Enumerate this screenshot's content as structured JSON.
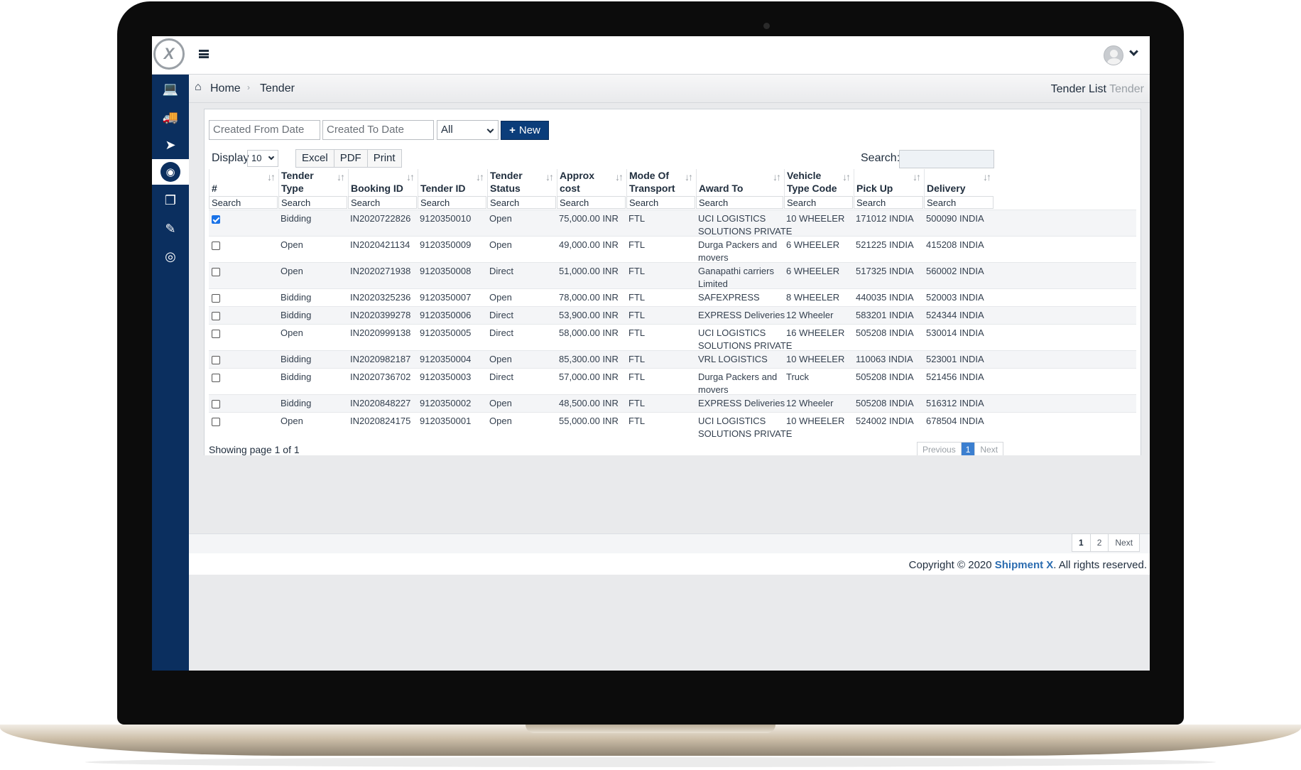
{
  "app": {
    "logo_letter": "X",
    "breadcrumb": {
      "home": "Home",
      "separator": "›",
      "current": "Tender"
    },
    "page_title": {
      "main": "Tender List",
      "sub": "Tender"
    }
  },
  "sidebar": {
    "items": [
      {
        "icon": "laptop-icon",
        "glyph": "💻"
      },
      {
        "icon": "truck-icon",
        "glyph": "🚚"
      },
      {
        "icon": "paper-plane-icon",
        "glyph": "➤"
      },
      {
        "icon": "eye-icon",
        "glyph": "◉",
        "active": true
      },
      {
        "icon": "copy-icon",
        "glyph": "❐"
      },
      {
        "icon": "pill-icon",
        "glyph": "✎"
      },
      {
        "icon": "target-icon",
        "glyph": "◎"
      }
    ]
  },
  "filters": {
    "from_placeholder": "Created From Date",
    "to_placeholder": "Created To Date",
    "status_value": "All",
    "new_button": "New",
    "new_icon": "+"
  },
  "toolbar": {
    "display_label": "Display",
    "display_value": "10",
    "excel": "Excel",
    "pdf": "PDF",
    "print": "Print",
    "search_label": "Search:"
  },
  "table": {
    "columns": [
      {
        "line1": "",
        "line2": "#"
      },
      {
        "line1": "Tender",
        "line2": "Type"
      },
      {
        "line1": "",
        "line2": "Booking ID"
      },
      {
        "line1": "",
        "line2": "Tender ID"
      },
      {
        "line1": "Tender",
        "line2": "Status"
      },
      {
        "line1": "Approx",
        "line2": "cost"
      },
      {
        "line1": "Mode Of",
        "line2": "Transport"
      },
      {
        "line1": "",
        "line2": "Award To"
      },
      {
        "line1": "Vehicle",
        "line2": "Type Code"
      },
      {
        "line1": "",
        "line2": "Pick Up"
      },
      {
        "line1": "",
        "line2": "Delivery"
      }
    ],
    "search_placeholder": "Search",
    "rows": [
      {
        "checked": true,
        "type": "Bidding",
        "booking": "IN2020722826",
        "tender_id": "9120350010",
        "status": "Open",
        "cost": "75,000.00 INR",
        "mode": "FTL",
        "award": [
          "UCI LOGISTICS",
          "SOLUTIONS PRIVATE"
        ],
        "vehicle": "10 WHEELER",
        "pickup": "171012 INDIA",
        "delivery": "500090 INDIA"
      },
      {
        "checked": false,
        "type": "Open",
        "booking": "IN2020421134",
        "tender_id": "9120350009",
        "status": "Open",
        "cost": "49,000.00 INR",
        "mode": "FTL",
        "award": [
          "Durga Packers and",
          "movers"
        ],
        "vehicle": "6 WHEELER",
        "pickup": "521225 INDIA",
        "delivery": "415208 INDIA"
      },
      {
        "checked": false,
        "type": "Open",
        "booking": "IN2020271938",
        "tender_id": "9120350008",
        "status": "Direct",
        "cost": "51,000.00 INR",
        "mode": "FTL",
        "award": [
          "Ganapathi carriers",
          "Limited"
        ],
        "vehicle": "6 WHEELER",
        "pickup": "517325 INDIA",
        "delivery": "560002 INDIA"
      },
      {
        "checked": false,
        "type": "Bidding",
        "booking": "IN2020325236",
        "tender_id": "9120350007",
        "status": "Open",
        "cost": "78,000.00 INR",
        "mode": "FTL",
        "award": [
          "SAFEXPRESS",
          ""
        ],
        "vehicle": "8 WHEELER",
        "pickup": "440035 INDIA",
        "delivery": "520003 INDIA"
      },
      {
        "checked": false,
        "type": "Bidding",
        "booking": "IN2020399278",
        "tender_id": "9120350006",
        "status": "Direct",
        "cost": "53,900.00 INR",
        "mode": "FTL",
        "award": [
          "EXPRESS Deliveries",
          ""
        ],
        "vehicle": "12 Wheeler",
        "pickup": "583201 INDIA",
        "delivery": "524344 INDIA"
      },
      {
        "checked": false,
        "type": "Open",
        "booking": "IN2020999138",
        "tender_id": "9120350005",
        "status": "Direct",
        "cost": "58,000.00 INR",
        "mode": "FTL",
        "award": [
          "UCI LOGISTICS",
          "SOLUTIONS PRIVATE"
        ],
        "vehicle": "16 WHEELER",
        "pickup": "505208 INDIA",
        "delivery": "530014 INDIA"
      },
      {
        "checked": false,
        "type": "Bidding",
        "booking": "IN2020982187",
        "tender_id": "9120350004",
        "status": "Open",
        "cost": "85,300.00 INR",
        "mode": "FTL",
        "award": [
          "VRL LOGISTICS",
          ""
        ],
        "vehicle": "10 WHEELER",
        "pickup": "110063 INDIA",
        "delivery": "523001 INDIA"
      },
      {
        "checked": false,
        "type": "Bidding",
        "booking": "IN2020736702",
        "tender_id": "9120350003",
        "status": "Direct",
        "cost": "57,000.00 INR",
        "mode": "FTL",
        "award": [
          "Durga Packers and",
          "movers"
        ],
        "vehicle": "Truck",
        "pickup": "505208 INDIA",
        "delivery": "521456 INDIA"
      },
      {
        "checked": false,
        "type": "Bidding",
        "booking": "IN2020848227",
        "tender_id": "9120350002",
        "status": "Open",
        "cost": "48,500.00 INR",
        "mode": "FTL",
        "award": [
          "EXPRESS Deliveries",
          ""
        ],
        "vehicle": "12 Wheeler",
        "pickup": "505208 INDIA",
        "delivery": "516312 INDIA"
      },
      {
        "checked": false,
        "type": "Open",
        "booking": "IN2020824175",
        "tender_id": "9120350001",
        "status": "Open",
        "cost": "55,000.00 INR",
        "mode": "FTL",
        "award": [
          "UCI LOGISTICS",
          "SOLUTIONS PRIVATE"
        ],
        "vehicle": "10 WHEELER",
        "pickup": "524002 INDIA",
        "delivery": "678504 INDIA"
      }
    ]
  },
  "pagination": {
    "showing": "Showing page 1 of 1",
    "previous": "Previous",
    "current": "1",
    "next": "Next"
  },
  "bottom_pagination": {
    "page1": "1",
    "page2": "2",
    "next": "Next"
  },
  "footer": {
    "prefix": "Copyright © 2020 ",
    "brand": "Shipment X",
    "suffix": ". All rights reserved."
  },
  "colors": {
    "sidebar": "#0b2f5f",
    "primary_button": "#0b3d7a",
    "active_page": "#3b7fd0",
    "brand_link": "#2b6cb0"
  }
}
